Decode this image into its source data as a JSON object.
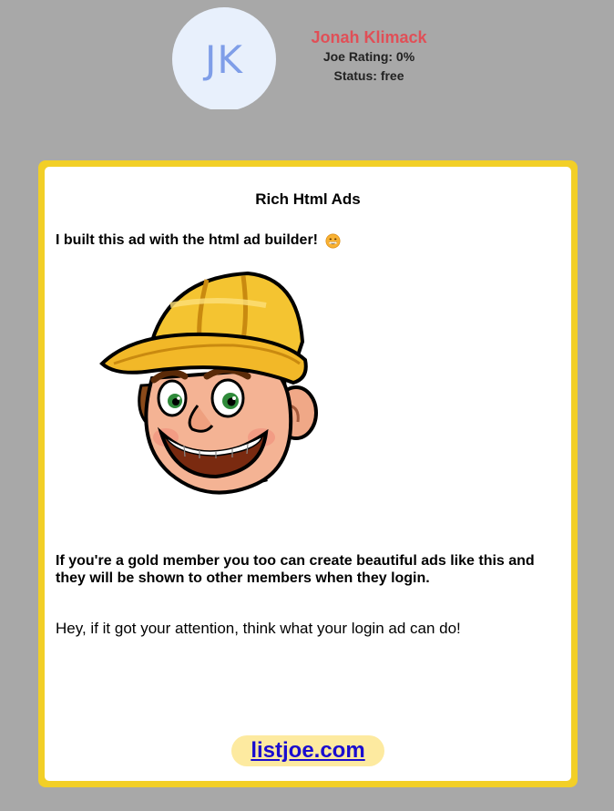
{
  "profile": {
    "initials": "JK",
    "name": "Jonah Klimack",
    "rating_line": "Joe Rating: 0%",
    "status_line": "Status: free"
  },
  "ad": {
    "title": "Rich Html Ads",
    "intro": "I built this ad with the html ad builder!",
    "intro_emoji": "grinning-face-icon",
    "image": "construction-worker-mascot",
    "pitch": "If you're a gold member you too can create beautiful ads like this and they will be shown to other members when they login.",
    "body": "Hey, if it got your attention, think what your login ad can do!",
    "link": "listjoe.com"
  },
  "colors": {
    "page_background": "#a8a8a8",
    "avatar_background": "#e8f0fc",
    "avatar_text": "#7f9ee8",
    "name_text": "#e04f57",
    "ad_border": "#f2cf27",
    "link_pill": "#fdeaa0",
    "link_text": "#1a0dcf"
  }
}
